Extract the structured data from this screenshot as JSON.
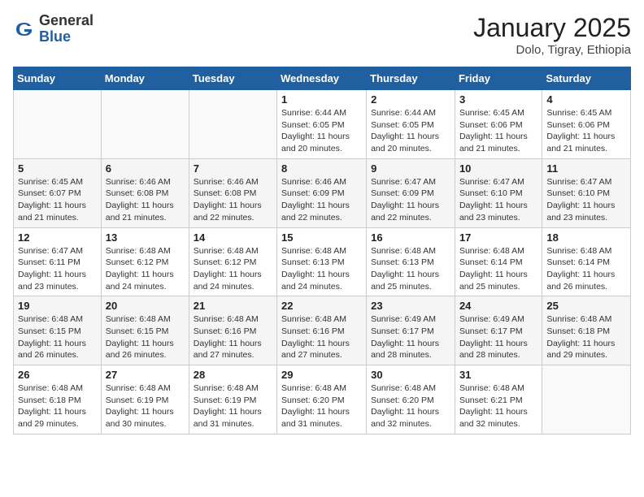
{
  "header": {
    "logo_general": "General",
    "logo_blue": "Blue",
    "title": "January 2025",
    "subtitle": "Dolo, Tigray, Ethiopia"
  },
  "days_of_week": [
    "Sunday",
    "Monday",
    "Tuesday",
    "Wednesday",
    "Thursday",
    "Friday",
    "Saturday"
  ],
  "weeks": [
    [
      {
        "day": "",
        "info": ""
      },
      {
        "day": "",
        "info": ""
      },
      {
        "day": "",
        "info": ""
      },
      {
        "day": "1",
        "info": "Sunrise: 6:44 AM\nSunset: 6:05 PM\nDaylight: 11 hours\nand 20 minutes."
      },
      {
        "day": "2",
        "info": "Sunrise: 6:44 AM\nSunset: 6:05 PM\nDaylight: 11 hours\nand 20 minutes."
      },
      {
        "day": "3",
        "info": "Sunrise: 6:45 AM\nSunset: 6:06 PM\nDaylight: 11 hours\nand 21 minutes."
      },
      {
        "day": "4",
        "info": "Sunrise: 6:45 AM\nSunset: 6:06 PM\nDaylight: 11 hours\nand 21 minutes."
      }
    ],
    [
      {
        "day": "5",
        "info": "Sunrise: 6:45 AM\nSunset: 6:07 PM\nDaylight: 11 hours\nand 21 minutes."
      },
      {
        "day": "6",
        "info": "Sunrise: 6:46 AM\nSunset: 6:08 PM\nDaylight: 11 hours\nand 21 minutes."
      },
      {
        "day": "7",
        "info": "Sunrise: 6:46 AM\nSunset: 6:08 PM\nDaylight: 11 hours\nand 22 minutes."
      },
      {
        "day": "8",
        "info": "Sunrise: 6:46 AM\nSunset: 6:09 PM\nDaylight: 11 hours\nand 22 minutes."
      },
      {
        "day": "9",
        "info": "Sunrise: 6:47 AM\nSunset: 6:09 PM\nDaylight: 11 hours\nand 22 minutes."
      },
      {
        "day": "10",
        "info": "Sunrise: 6:47 AM\nSunset: 6:10 PM\nDaylight: 11 hours\nand 23 minutes."
      },
      {
        "day": "11",
        "info": "Sunrise: 6:47 AM\nSunset: 6:10 PM\nDaylight: 11 hours\nand 23 minutes."
      }
    ],
    [
      {
        "day": "12",
        "info": "Sunrise: 6:47 AM\nSunset: 6:11 PM\nDaylight: 11 hours\nand 23 minutes."
      },
      {
        "day": "13",
        "info": "Sunrise: 6:48 AM\nSunset: 6:12 PM\nDaylight: 11 hours\nand 24 minutes."
      },
      {
        "day": "14",
        "info": "Sunrise: 6:48 AM\nSunset: 6:12 PM\nDaylight: 11 hours\nand 24 minutes."
      },
      {
        "day": "15",
        "info": "Sunrise: 6:48 AM\nSunset: 6:13 PM\nDaylight: 11 hours\nand 24 minutes."
      },
      {
        "day": "16",
        "info": "Sunrise: 6:48 AM\nSunset: 6:13 PM\nDaylight: 11 hours\nand 25 minutes."
      },
      {
        "day": "17",
        "info": "Sunrise: 6:48 AM\nSunset: 6:14 PM\nDaylight: 11 hours\nand 25 minutes."
      },
      {
        "day": "18",
        "info": "Sunrise: 6:48 AM\nSunset: 6:14 PM\nDaylight: 11 hours\nand 26 minutes."
      }
    ],
    [
      {
        "day": "19",
        "info": "Sunrise: 6:48 AM\nSunset: 6:15 PM\nDaylight: 11 hours\nand 26 minutes."
      },
      {
        "day": "20",
        "info": "Sunrise: 6:48 AM\nSunset: 6:15 PM\nDaylight: 11 hours\nand 26 minutes."
      },
      {
        "day": "21",
        "info": "Sunrise: 6:48 AM\nSunset: 6:16 PM\nDaylight: 11 hours\nand 27 minutes."
      },
      {
        "day": "22",
        "info": "Sunrise: 6:48 AM\nSunset: 6:16 PM\nDaylight: 11 hours\nand 27 minutes."
      },
      {
        "day": "23",
        "info": "Sunrise: 6:49 AM\nSunset: 6:17 PM\nDaylight: 11 hours\nand 28 minutes."
      },
      {
        "day": "24",
        "info": "Sunrise: 6:49 AM\nSunset: 6:17 PM\nDaylight: 11 hours\nand 28 minutes."
      },
      {
        "day": "25",
        "info": "Sunrise: 6:48 AM\nSunset: 6:18 PM\nDaylight: 11 hours\nand 29 minutes."
      }
    ],
    [
      {
        "day": "26",
        "info": "Sunrise: 6:48 AM\nSunset: 6:18 PM\nDaylight: 11 hours\nand 29 minutes."
      },
      {
        "day": "27",
        "info": "Sunrise: 6:48 AM\nSunset: 6:19 PM\nDaylight: 11 hours\nand 30 minutes."
      },
      {
        "day": "28",
        "info": "Sunrise: 6:48 AM\nSunset: 6:19 PM\nDaylight: 11 hours\nand 31 minutes."
      },
      {
        "day": "29",
        "info": "Sunrise: 6:48 AM\nSunset: 6:20 PM\nDaylight: 11 hours\nand 31 minutes."
      },
      {
        "day": "30",
        "info": "Sunrise: 6:48 AM\nSunset: 6:20 PM\nDaylight: 11 hours\nand 32 minutes."
      },
      {
        "day": "31",
        "info": "Sunrise: 6:48 AM\nSunset: 6:21 PM\nDaylight: 11 hours\nand 32 minutes."
      },
      {
        "day": "",
        "info": ""
      }
    ]
  ]
}
